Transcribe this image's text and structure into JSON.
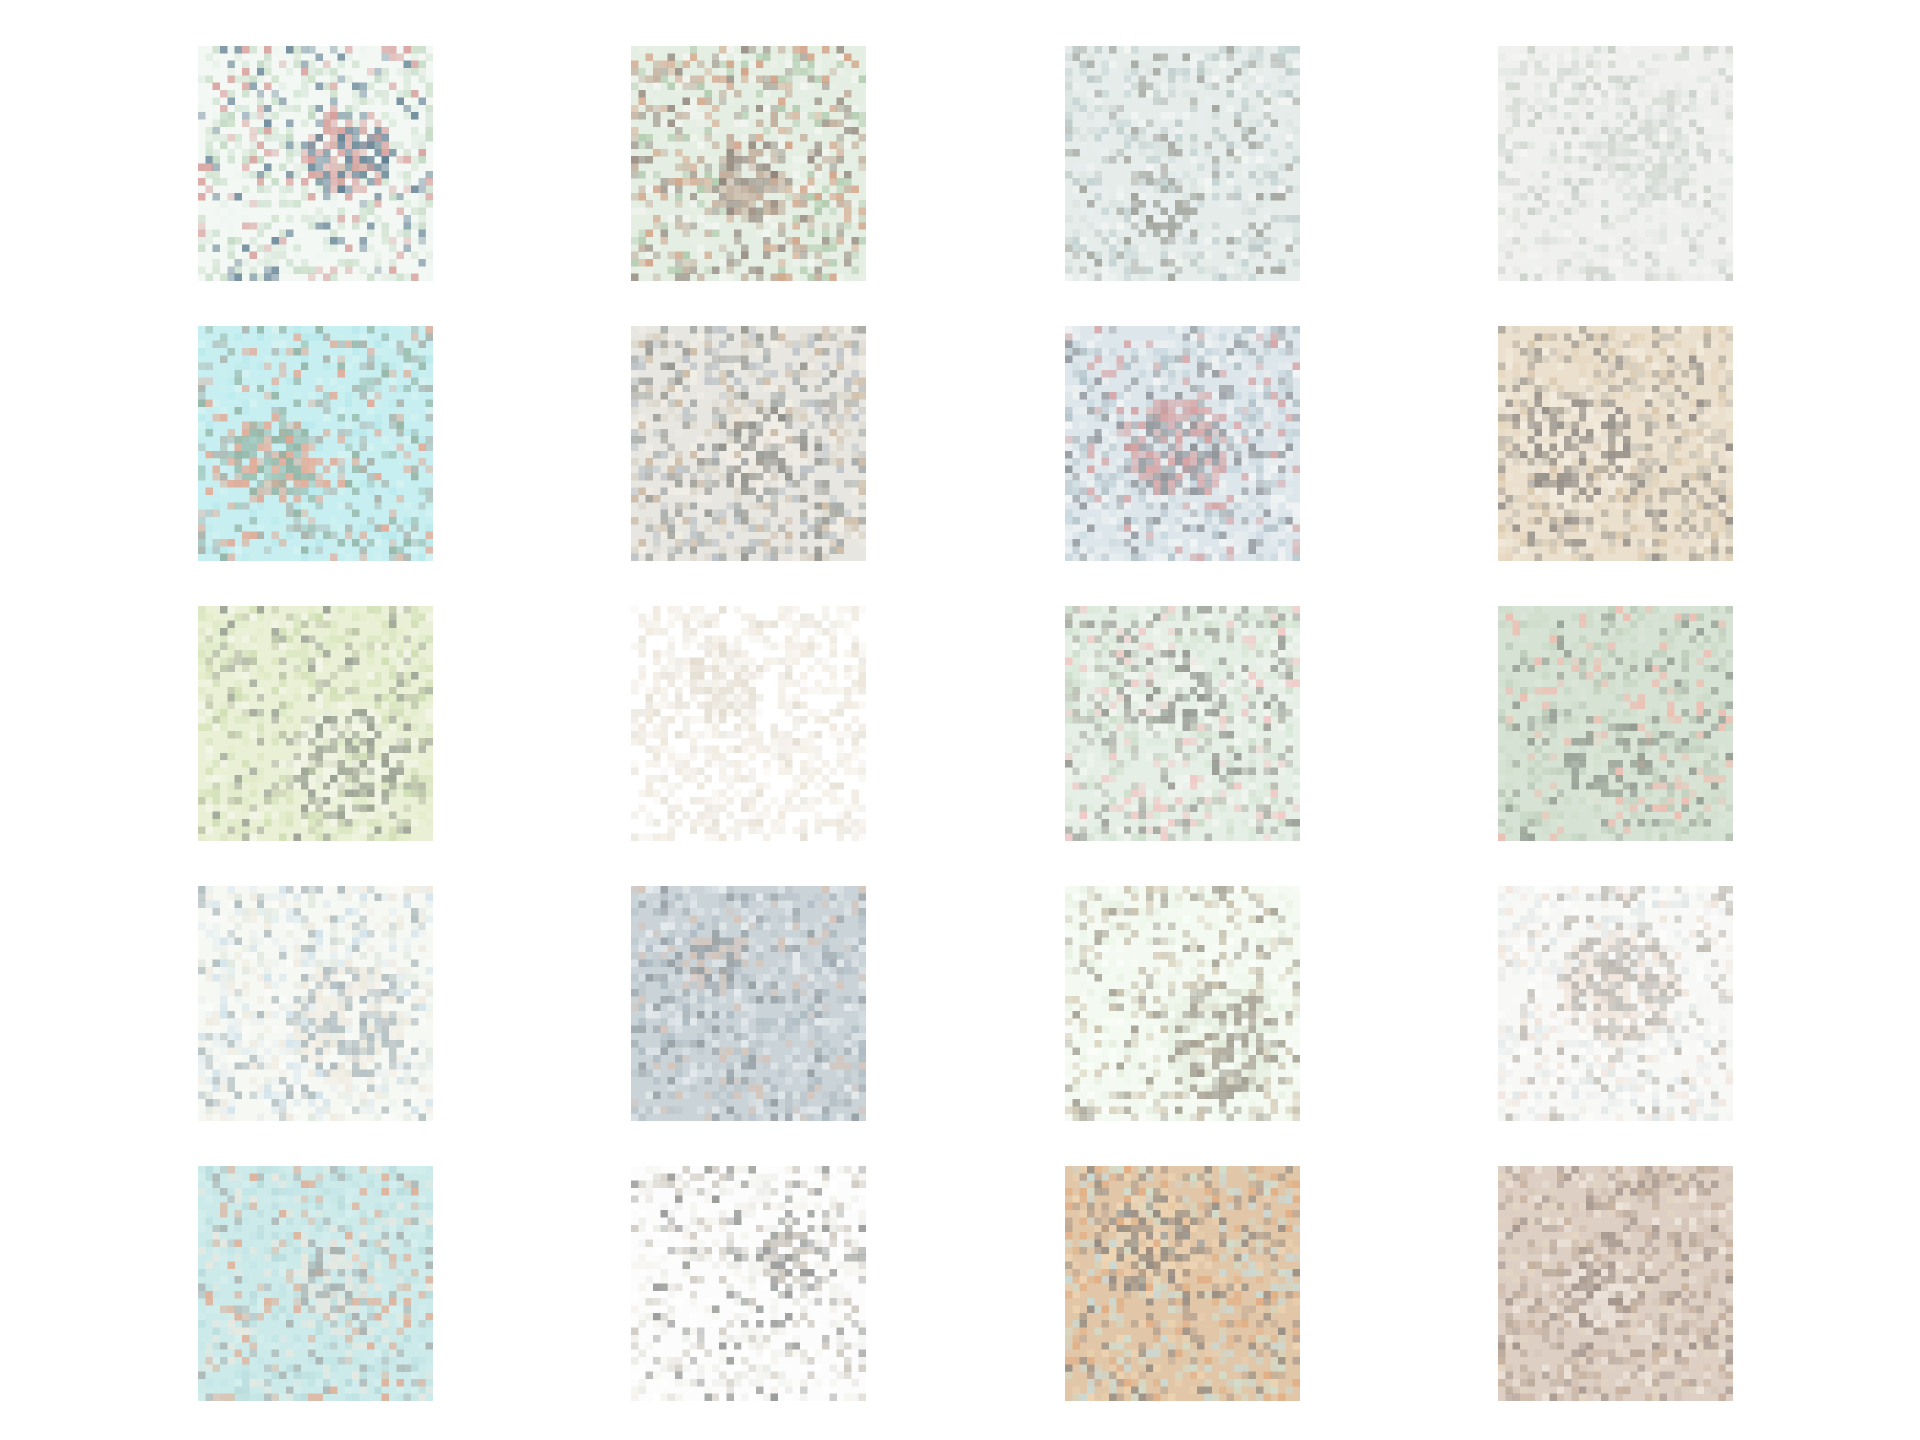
{
  "grid": {
    "rows": 5,
    "columns": 4,
    "tiles": [
      {
        "row": 1,
        "col": 1,
        "bg": "#f3f8f5",
        "colors": [
          "#eef6f0",
          "#dbe9dc",
          "#5e7d90",
          "#d59a96",
          "#c9ddc7",
          "#bed7bf"
        ]
      },
      {
        "row": 1,
        "col": 2,
        "bg": "#e4eee2",
        "colors": [
          "#aac7a8",
          "#f5f6f3",
          "#bfa896",
          "#8f8279",
          "#eaf0e7",
          "#d19a7c"
        ]
      },
      {
        "row": 1,
        "col": 3,
        "bg": "#e5ecea",
        "colors": [
          "#bed0cf",
          "#f5f7f5",
          "#e8eeee",
          "#9b9c95",
          "#d8e2df",
          "#b8c6c4"
        ]
      },
      {
        "row": 1,
        "col": 4,
        "bg": "#f0f1ef",
        "colors": [
          "#f5f5f3",
          "#e8eae7",
          "#ced4ce",
          "#dfe3de",
          "#eef0ed",
          "#c4c9c3"
        ]
      },
      {
        "row": 2,
        "col": 1,
        "bg": "#c7eef0",
        "colors": [
          "#b7e9ec",
          "#c9f0ee",
          "#8dae9c",
          "#e5a48e",
          "#a7a9a1",
          "#d7f3f2"
        ]
      },
      {
        "row": 2,
        "col": 2,
        "bg": "#e7e6e0",
        "colors": [
          "#d8d3c6",
          "#b5bcc4",
          "#8b8b85",
          "#f3efe7",
          "#c9b59e",
          "#9ea4a3"
        ]
      },
      {
        "row": 2,
        "col": 3,
        "bg": "#dde6ea",
        "colors": [
          "#c6d6de",
          "#eef2f3",
          "#8b9095",
          "#d59e9f",
          "#f5f6f6",
          "#aebfc6"
        ]
      },
      {
        "row": 2,
        "col": 4,
        "bg": "#ebe0cd",
        "colors": [
          "#e4d4bc",
          "#c6c1b6",
          "#8c8782",
          "#f3ece0",
          "#d5c3a7",
          "#a9a297"
        ]
      },
      {
        "row": 3,
        "col": 1,
        "bg": "#eaf0d6",
        "colors": [
          "#e1ebc7",
          "#cddcaf",
          "#90968b",
          "#f4f6ea",
          "#b7bfa2",
          "#d8e4bd"
        ]
      },
      {
        "row": 3,
        "col": 2,
        "bg": "#ffffff",
        "colors": [
          "#f3ede3",
          "#ebe3d5",
          "#e2dccf",
          "#f7f4ee",
          "#efe8dd",
          "#e8e4dc"
        ]
      },
      {
        "row": 3,
        "col": 3,
        "bg": "#e6efe6",
        "colors": [
          "#d7e7d6",
          "#b1b3a7",
          "#8f928a",
          "#f3f6f2",
          "#c8dbc6",
          "#f1c4c2"
        ]
      },
      {
        "row": 3,
        "col": 4,
        "bg": "#d6e2d3",
        "colors": [
          "#cfdccb",
          "#c7d7c4",
          "#8f978c",
          "#dbe6d8",
          "#b9c8b6",
          "#f0b9ad"
        ]
      },
      {
        "row": 4,
        "col": 1,
        "bg": "#f6f8f4",
        "colors": [
          "#fbfcfa",
          "#cfe1ea",
          "#a8b5b8",
          "#efeadf",
          "#e8efef",
          "#dfe7de"
        ]
      },
      {
        "row": 4,
        "col": 2,
        "bg": "#c9d3d8",
        "colors": [
          "#b9c3c8",
          "#dfe6e8",
          "#8f989d",
          "#d7c3b7",
          "#aab8bf",
          "#e9eef0"
        ]
      },
      {
        "row": 4,
        "col": 3,
        "bg": "#f4faf1",
        "colors": [
          "#eef6ea",
          "#d6cdb8",
          "#9c978a",
          "#e4eedf",
          "#c3baa5",
          "#fbfdfa"
        ]
      },
      {
        "row": 4,
        "col": 4,
        "bg": "#f8f9f7",
        "colors": [
          "#fdfdfc",
          "#e7eaea",
          "#b9b4ad",
          "#efe2d8",
          "#dde4e4",
          "#f3f5f3"
        ]
      },
      {
        "row": 5,
        "col": 1,
        "bg": "#cdeaea",
        "colors": [
          "#c1e4e5",
          "#d6eeee",
          "#a4aaa8",
          "#ebe8df",
          "#b5d9d9",
          "#e1a98e"
        ]
      },
      {
        "row": 5,
        "col": 2,
        "bg": "#fbfcfb",
        "colors": [
          "#ffffff",
          "#f1f1ee",
          "#c9c3b9",
          "#8b8d8b",
          "#e8e7e3",
          "#f5f2ec"
        ]
      },
      {
        "row": 5,
        "col": 3,
        "bg": "#e1c7a8",
        "colors": [
          "#e2a97c",
          "#c7dcdc",
          "#8e8780",
          "#f0d6b4",
          "#cfe1d2",
          "#b6a08f"
        ]
      },
      {
        "row": 5,
        "col": 4,
        "bg": "#ddcfc4",
        "colors": [
          "#d2c1b4",
          "#c4ac98",
          "#9c8e86",
          "#efe6dd",
          "#b3a394",
          "#e4d6c2"
        ]
      }
    ]
  }
}
